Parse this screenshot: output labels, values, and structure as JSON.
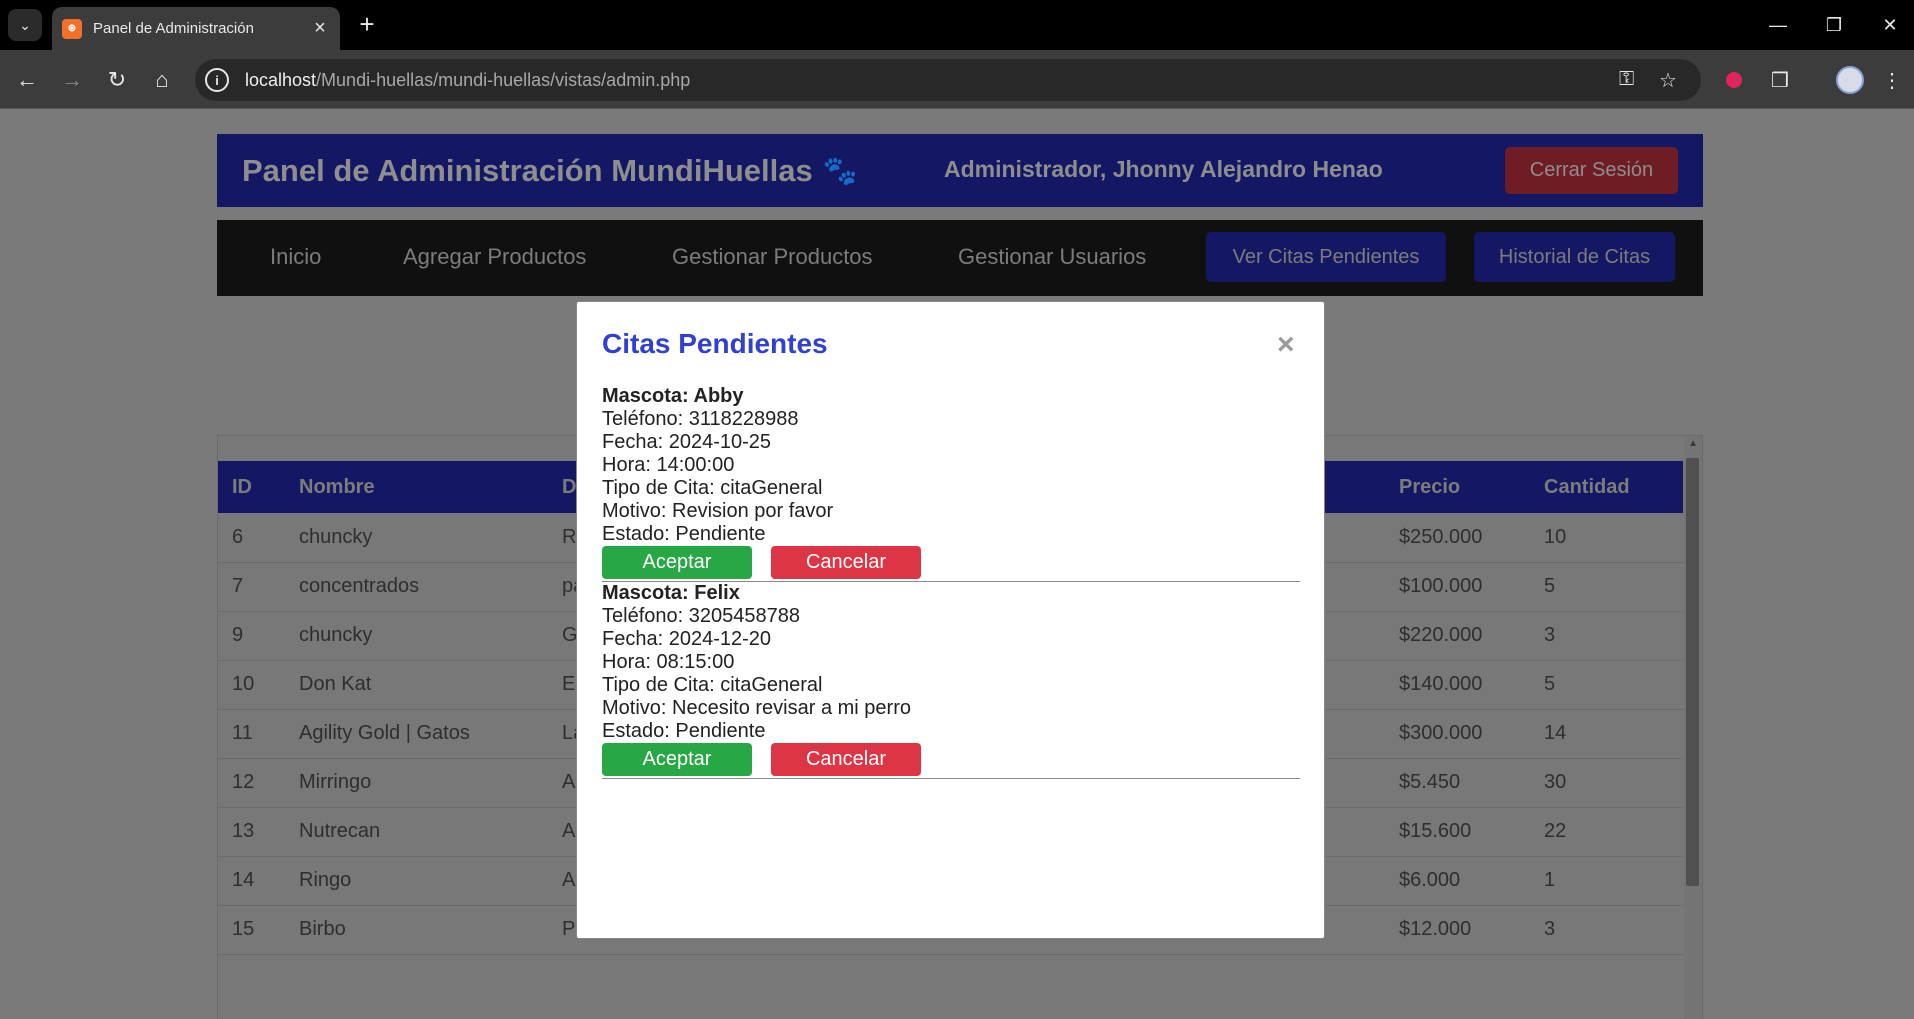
{
  "browser": {
    "tab_title": "Panel de Administración",
    "url_host": "localhost",
    "url_path": "/Mundi-huellas/mundi-huellas/vistas/admin.php"
  },
  "header": {
    "title": "Panel de Administración MundiHuellas",
    "user": "Administrador, Jhonny Alejandro Henao",
    "logout_label": "Cerrar Sesión"
  },
  "nav": {
    "inicio": "Inicio",
    "agregar": "Agregar Productos",
    "gestionar_productos": "Gestionar Productos",
    "gestionar_usuarios": "Gestionar Usuarios",
    "citas_pendientes": "Ver Citas Pendientes",
    "historial": "Historial de Citas"
  },
  "table": {
    "headers": {
      "id": "ID",
      "nombre": "Nombre",
      "desc": "D",
      "precio": "Precio",
      "cantidad": "Cantidad"
    },
    "rows": [
      {
        "id": "6",
        "nombre": "chuncky",
        "desc": "Ra",
        "precio": "$250.000",
        "cantidad": "10"
      },
      {
        "id": "7",
        "nombre": "concentrados",
        "desc": "pa",
        "precio": "$100.000",
        "cantidad": "5"
      },
      {
        "id": "9",
        "nombre": "chuncky",
        "desc": "Gi",
        "precio": "$220.000",
        "cantidad": "3"
      },
      {
        "id": "10",
        "nombre": "Don Kat",
        "desc": "El",
        "precio": "$140.000",
        "cantidad": "5"
      },
      {
        "id": "11",
        "nombre": "Agility Gold | Gatos",
        "desc": "La",
        "precio": "$300.000",
        "cantidad": "14"
      },
      {
        "id": "12",
        "nombre": "Mirringo",
        "desc": "Al",
        "precio": "$5.450",
        "cantidad": "30"
      },
      {
        "id": "13",
        "nombre": "Nutrecan",
        "desc": "Al",
        "precio": "$15.600",
        "cantidad": "22"
      },
      {
        "id": "14",
        "nombre": "Ringo",
        "desc": "Al",
        "precio": "$6.000",
        "cantidad": "1"
      },
      {
        "id": "15",
        "nombre": "Birbo",
        "desc": "Pa",
        "precio": "$12.000",
        "cantidad": "3"
      }
    ]
  },
  "modal": {
    "title": "Citas Pendientes",
    "close": "×",
    "accept_label": "Aceptar",
    "cancel_label": "Cancelar",
    "appointments": [
      {
        "mascota": "Mascota: Abby",
        "telefono": "Teléfono: 3118228988",
        "fecha": "Fecha: 2024-10-25",
        "hora": "Hora: 14:00:00",
        "tipo": "Tipo de Cita: citaGeneral",
        "motivo": "Motivo: Revision por favor",
        "estado": "Estado: Pendiente"
      },
      {
        "mascota": "Mascota: Felix",
        "telefono": "Teléfono: 3205458788",
        "fecha": "Fecha: 2024-12-20",
        "hora": "Hora: 08:15:00",
        "tipo": "Tipo de Cita: citaGeneral",
        "motivo": "Motivo: Necesito revisar a mi perro",
        "estado": "Estado: Pendiente"
      }
    ]
  }
}
